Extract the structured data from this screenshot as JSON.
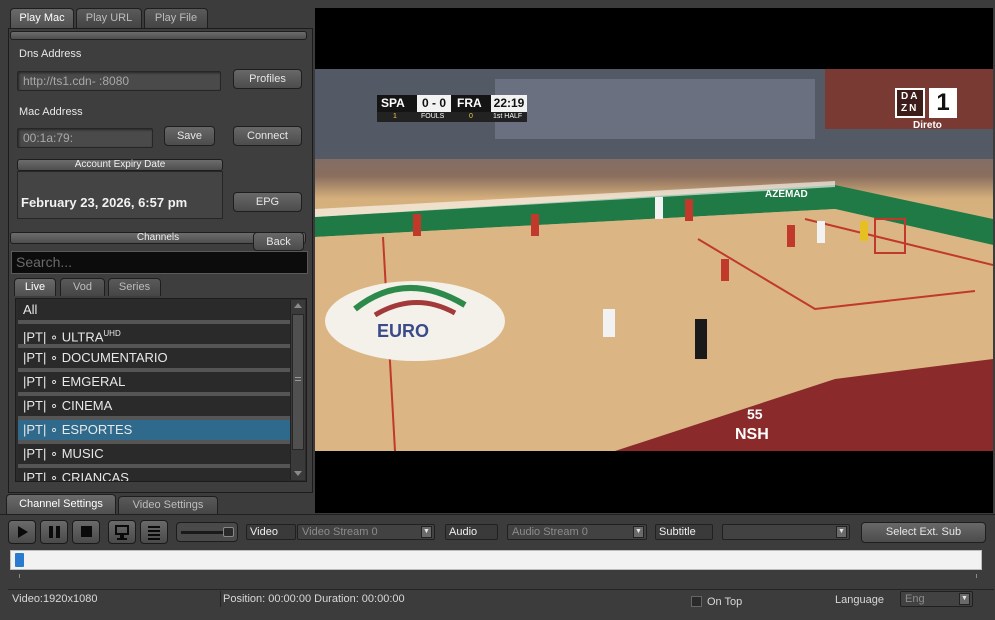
{
  "tabs": [
    "Play Mac",
    "Play URL",
    "Play File"
  ],
  "dns": {
    "label": "Dns Address",
    "value": "http://ts1.cdn-          :8080"
  },
  "profiles_label": "Profiles",
  "mac": {
    "label": "Mac Address",
    "value": "00:1a:79:"
  },
  "save_label": "Save",
  "connect_label": "Connect",
  "expiry": {
    "header": "Account Expiry Date",
    "value": "February 23, 2026, 6:57 pm"
  },
  "epg_label": "EPG",
  "channels_header": "Channels",
  "back_label": "Back",
  "search_placeholder": "Search...",
  "channel_tabs": [
    "Live",
    "Vod",
    "Series"
  ],
  "channels": [
    {
      "name": "All",
      "suffix": ""
    },
    {
      "name": "|PT| ∘ ULTRA",
      "suffix": "UHD"
    },
    {
      "name": "|PT| ∘ DOCUMENTARIO",
      "suffix": ""
    },
    {
      "name": "|PT| ∘ EMGERAL",
      "suffix": ""
    },
    {
      "name": "|PT| ∘ CINEMA",
      "suffix": ""
    },
    {
      "name": "|PT| ∘ ESPORTES",
      "suffix": ""
    },
    {
      "name": "|PT| ∘ MUSIC",
      "suffix": ""
    },
    {
      "name": "|PT| ∘ CRIANCAS",
      "suffix": ""
    }
  ],
  "selected_channel_index": 5,
  "settings_tabs": [
    "Channel Settings",
    "Video Settings"
  ],
  "scoreboard": {
    "home": "SPA",
    "score": "0 - 0",
    "away": "FRA",
    "clock": "22:19",
    "home_fouls": "1",
    "fouls_label": "FOULS",
    "away_fouls": "0",
    "period": "1st HALF"
  },
  "broadcaster": {
    "logo_top": "DA",
    "logo_bottom": "ZN",
    "channel": "1",
    "tag": "Direto"
  },
  "overlay": {
    "event_text": "EURO",
    "jersey_text": "NSH",
    "jersey_number": "55",
    "sponsor_text": "AZEMAD"
  },
  "controls": {
    "video_label": "Video",
    "video_stream": "Video Stream 0",
    "audio_label": "Audio",
    "audio_stream": "Audio Stream 0",
    "subtitle_label": "Subtitle",
    "subtitle_value": "",
    "select_sub_label": "Select Ext. Sub"
  },
  "progress": 0,
  "status": {
    "video_info": "Video:1920x1080",
    "position": "Position: 00:00:00 Duration: 00:00:00",
    "on_top_label": "On Top",
    "language_label": "Language",
    "language_value": "Eng"
  },
  "colors": {
    "accent": "#2f6a8c",
    "panel": "#3e3e3e",
    "background": "#3c3c3c"
  }
}
